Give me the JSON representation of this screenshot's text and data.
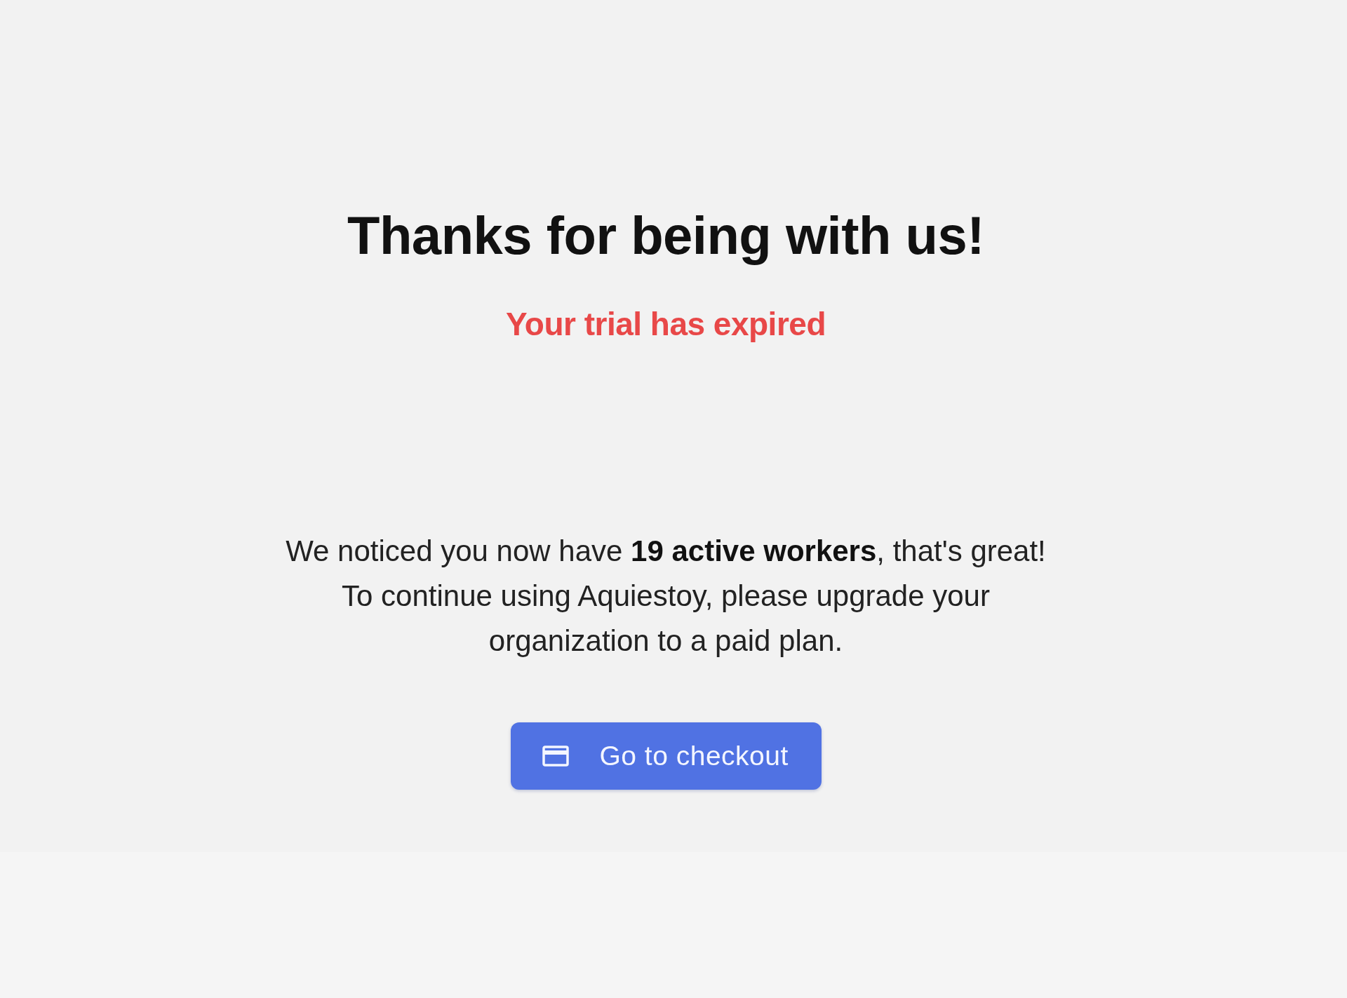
{
  "heading": "Thanks for being with us!",
  "status": "Your trial has expired",
  "message": "We noticed you now have **19 active workers**, that's great! To continue using Aquiestoy, please upgrade your organization to a paid plan.",
  "checkout_button": {
    "label": "Go to checkout"
  }
}
